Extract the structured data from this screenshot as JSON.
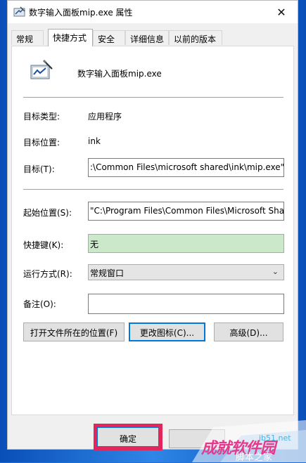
{
  "window": {
    "title": "数字输入面板mip.exe  属性",
    "close_glyph": "✕"
  },
  "tabs": [
    {
      "label": "常规",
      "active": false
    },
    {
      "label": "快捷方式",
      "active": true
    },
    {
      "label": "安全",
      "active": false
    },
    {
      "label": "详细信息",
      "active": false
    },
    {
      "label": "以前的版本",
      "active": false
    }
  ],
  "shortcut": {
    "app_name": "数字输入面板mip.exe",
    "target_type_label": "目标类型:",
    "target_type_value": "应用程序",
    "target_location_label": "目标位置:",
    "target_location_value": "ink",
    "target_label": "目标(T):",
    "target_value": ":\\Common Files\\microsoft shared\\ink\\mip.exe\"",
    "start_in_label": "起始位置(S):",
    "start_in_value": "\"C:\\Program Files\\Common Files\\Microsoft Sha",
    "hotkey_label": "快捷键(K):",
    "hotkey_value": "无",
    "run_label": "运行方式(R):",
    "run_value": "常规窗口",
    "comment_label": "备注(O):",
    "comment_value": ""
  },
  "buttons": {
    "open_location": "打开文件所在的位置(F)",
    "change_icon": "更改图标(C)...",
    "advanced": "高级(D)...",
    "ok": "确定"
  },
  "watermark": {
    "site": "jb51.net",
    "brand": "成就软件园",
    "sub": "脚本之家"
  },
  "colors": {
    "accent": "#0078d7",
    "highlight_box": "#e0265d",
    "hotkey_field": "#cbe8cb",
    "watermark_brand": "#e5398b"
  }
}
